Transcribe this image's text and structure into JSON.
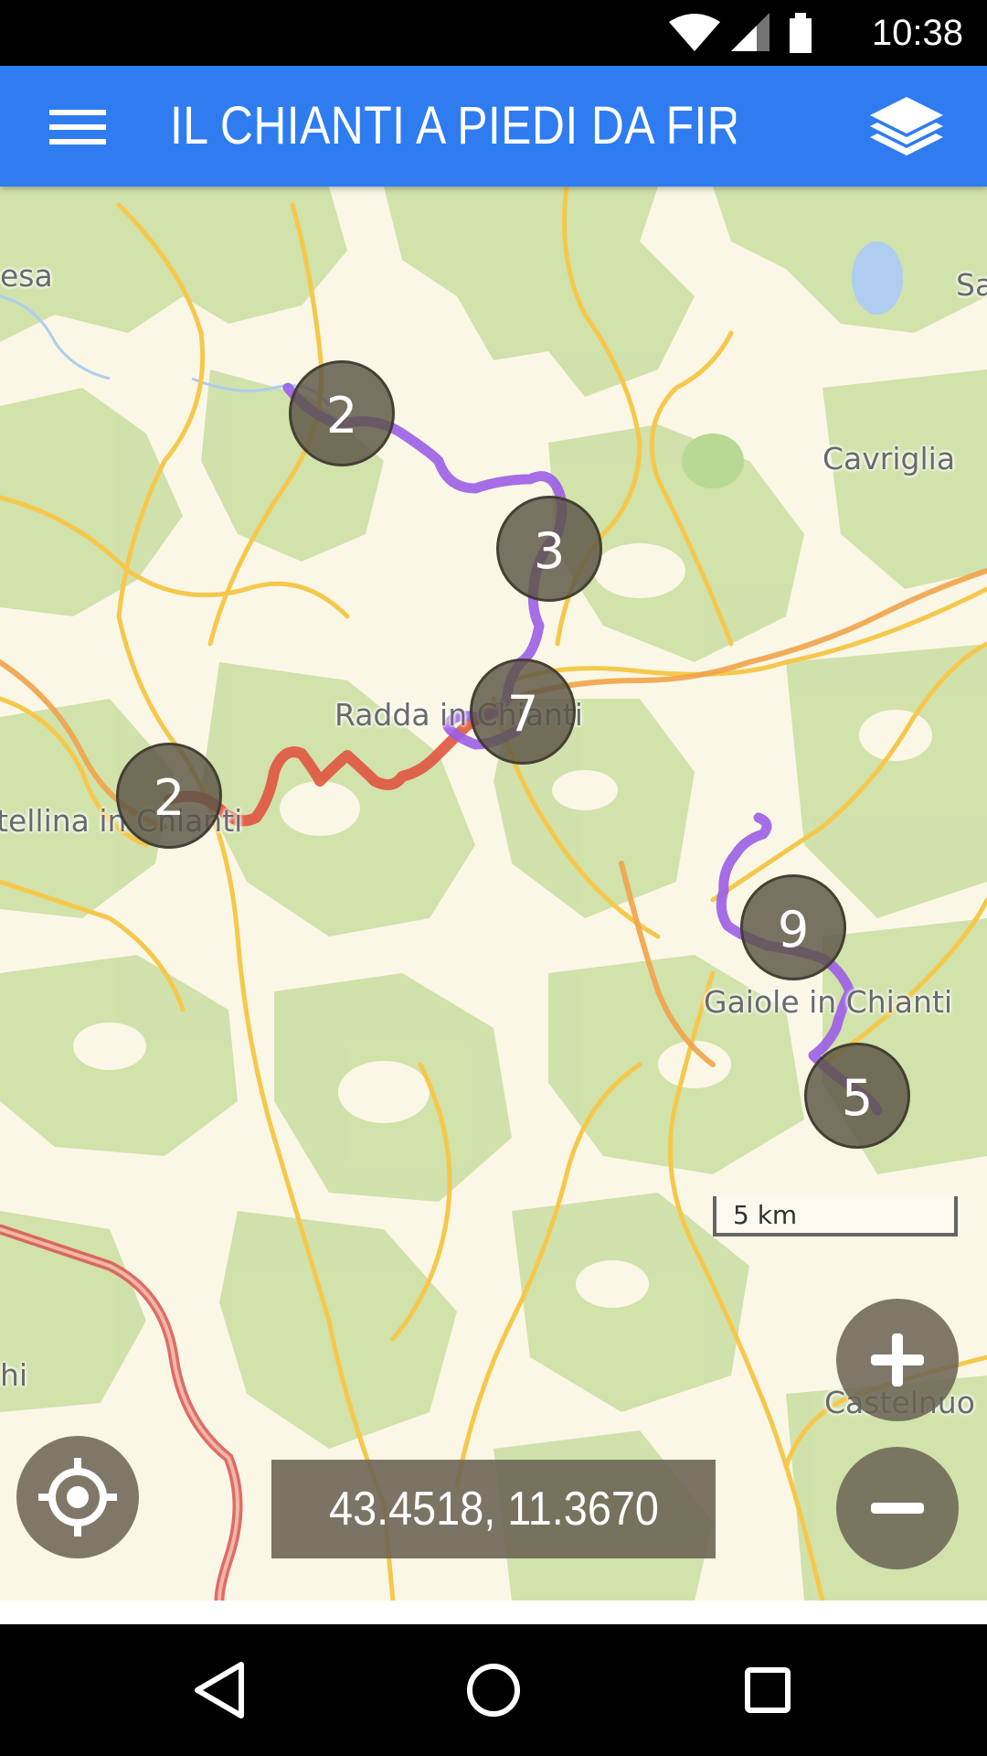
{
  "status_bar": {
    "time": "10:38"
  },
  "app_bar": {
    "title": "IL CHIANTI A PIEDI DA FIRE...",
    "menu_icon": "menu-icon",
    "layers_icon": "layers-icon"
  },
  "map": {
    "place_labels": [
      {
        "text": "Cavriglia"
      },
      {
        "text": "Radda in Chianti"
      },
      {
        "text": "tellina in Chianti"
      },
      {
        "text": "Gaiole in Chianti"
      },
      {
        "text": "Castelnuo"
      },
      {
        "text": "esa"
      },
      {
        "text": "Sa"
      },
      {
        "text": "hi"
      }
    ],
    "clusters": [
      {
        "count": "2"
      },
      {
        "count": "3"
      },
      {
        "count": "7"
      },
      {
        "count": "2"
      },
      {
        "count": "9"
      },
      {
        "count": "5"
      }
    ],
    "scale": "5 km",
    "coordinates": "43.4518, 11.3670",
    "colors": {
      "route_purple": "#9b5de5",
      "route_red": "#e0553f",
      "road_yellow": "#f5c84c",
      "road_red": "#d9534f",
      "forest": "#cfe0a8",
      "land": "#fbf7e6",
      "water": "#aecdf0"
    }
  },
  "controls": {
    "zoom_in_icon": "plus-icon",
    "zoom_out_icon": "minus-icon",
    "locate_icon": "crosshair-location-icon"
  },
  "nav_bar": {
    "back_icon": "back-triangle-icon",
    "home_icon": "home-circle-icon",
    "recents_icon": "recents-square-icon"
  }
}
